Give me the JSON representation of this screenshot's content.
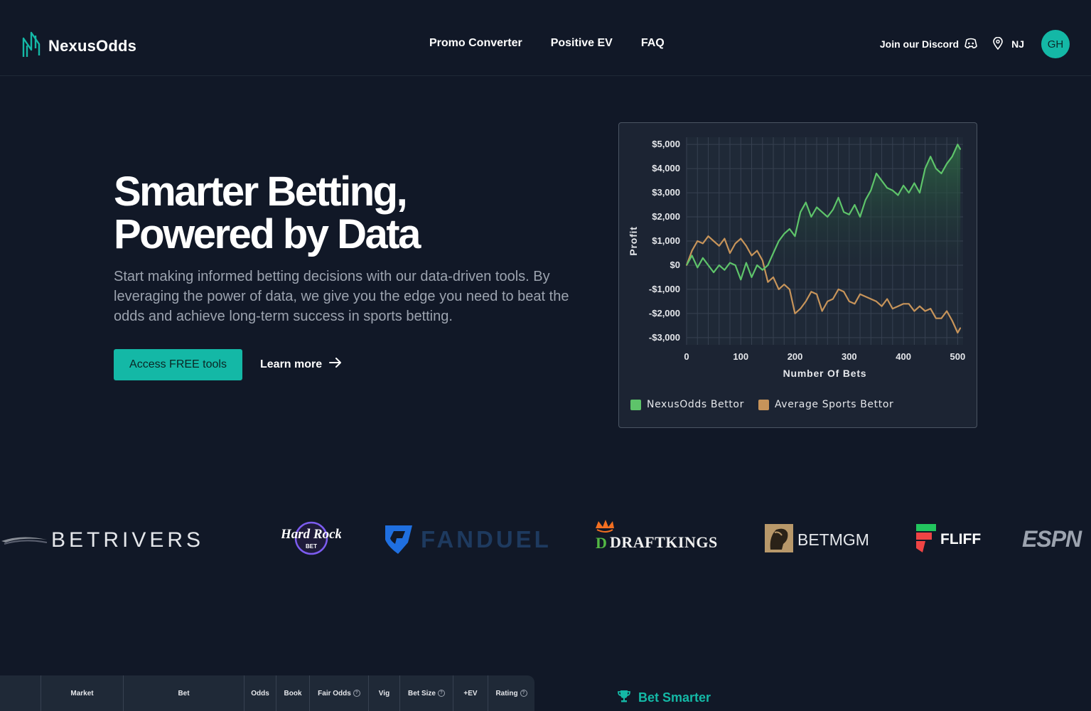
{
  "header": {
    "brand": "NexusOdds",
    "nav": [
      "Promo Converter",
      "Positive EV",
      "FAQ"
    ],
    "discord_label": "Join our Discord",
    "state": "NJ",
    "avatar_initials": "GH"
  },
  "hero": {
    "title_line1": "Smarter Betting,",
    "title_line2": "Powered by Data",
    "description": "Start making informed betting decisions with our data-driven tools. By leveraging the power of data, we give you the edge you need to beat the odds and achieve long-term success in sports betting.",
    "primary_button": "Access FREE tools",
    "secondary_link": "Learn more"
  },
  "chart_data": {
    "type": "line",
    "xlabel": "Number Of Bets",
    "ylabel": "Profit",
    "xlim": [
      0,
      510
    ],
    "ylim": [
      -3300,
      5300
    ],
    "x_ticks": [
      0,
      100,
      200,
      300,
      400,
      500
    ],
    "x_tick_labels": [
      "0",
      "100",
      "200",
      "300",
      "400",
      "500"
    ],
    "y_ticks": [
      5000,
      4000,
      3000,
      2000,
      1000,
      0,
      -1000,
      -2000,
      -3000
    ],
    "y_tick_labels": [
      "$5,000",
      "$4,000",
      "$3,000",
      "$2,000",
      "$1,000",
      "$0",
      "-$1,000",
      "-$2,000",
      "-$3,000"
    ],
    "grid": true,
    "legend_position": "bottom-left",
    "series": [
      {
        "name": "NexusOdds Bettor",
        "color": "#5ec46a",
        "x": [
          0,
          10,
          20,
          30,
          40,
          50,
          60,
          70,
          80,
          90,
          100,
          110,
          120,
          130,
          140,
          150,
          160,
          170,
          180,
          190,
          200,
          210,
          220,
          230,
          240,
          250,
          260,
          270,
          280,
          290,
          300,
          310,
          320,
          330,
          340,
          350,
          360,
          370,
          380,
          390,
          400,
          410,
          420,
          430,
          440,
          450,
          460,
          470,
          480,
          490,
          500,
          505
        ],
        "values": [
          0,
          400,
          -100,
          300,
          0,
          -300,
          0,
          -200,
          100,
          0,
          -600,
          100,
          -500,
          0,
          -200,
          0,
          500,
          1000,
          1300,
          1500,
          1200,
          2200,
          2600,
          2000,
          2400,
          2200,
          2000,
          2300,
          2800,
          2200,
          2100,
          2500,
          2000,
          2700,
          3100,
          3800,
          3500,
          3200,
          3100,
          2900,
          3300,
          3000,
          3400,
          3000,
          4000,
          4500,
          4000,
          3800,
          4200,
          4500,
          5000,
          4800
        ]
      },
      {
        "name": "Average Sports Bettor",
        "color": "#c7945a",
        "x": [
          0,
          10,
          20,
          30,
          40,
          50,
          60,
          70,
          80,
          90,
          100,
          110,
          120,
          130,
          140,
          150,
          160,
          170,
          180,
          190,
          200,
          210,
          220,
          230,
          240,
          250,
          260,
          270,
          280,
          290,
          300,
          310,
          320,
          330,
          340,
          350,
          360,
          370,
          380,
          390,
          400,
          410,
          420,
          430,
          440,
          450,
          460,
          470,
          480,
          490,
          500,
          505
        ],
        "values": [
          0,
          600,
          1000,
          900,
          1200,
          1000,
          800,
          1100,
          500,
          900,
          1100,
          800,
          400,
          600,
          200,
          -700,
          -500,
          -1000,
          -800,
          -1000,
          -2000,
          -1800,
          -1500,
          -1100,
          -1200,
          -1900,
          -1500,
          -1400,
          -1000,
          -1100,
          -1500,
          -1600,
          -1200,
          -1300,
          -1400,
          -1500,
          -1700,
          -1400,
          -1800,
          -1700,
          -1600,
          -1600,
          -1900,
          -1700,
          -1900,
          -1800,
          -2200,
          -2200,
          -1900,
          -2300,
          -2800,
          -2600
        ]
      }
    ]
  },
  "partners": [
    "BETRIVERS",
    "Hard Rock",
    "BET",
    "FANDUEL",
    "DRAFTKINGS",
    "BETMGM",
    "FLIFF",
    "ESPN"
  ],
  "table": {
    "headers": [
      "Market",
      "Bet",
      "Odds",
      "Book",
      "Fair Odds",
      "Vig",
      "Bet Size",
      "+EV",
      "Rating"
    ]
  },
  "bet_smarter": "Bet Smarter"
}
